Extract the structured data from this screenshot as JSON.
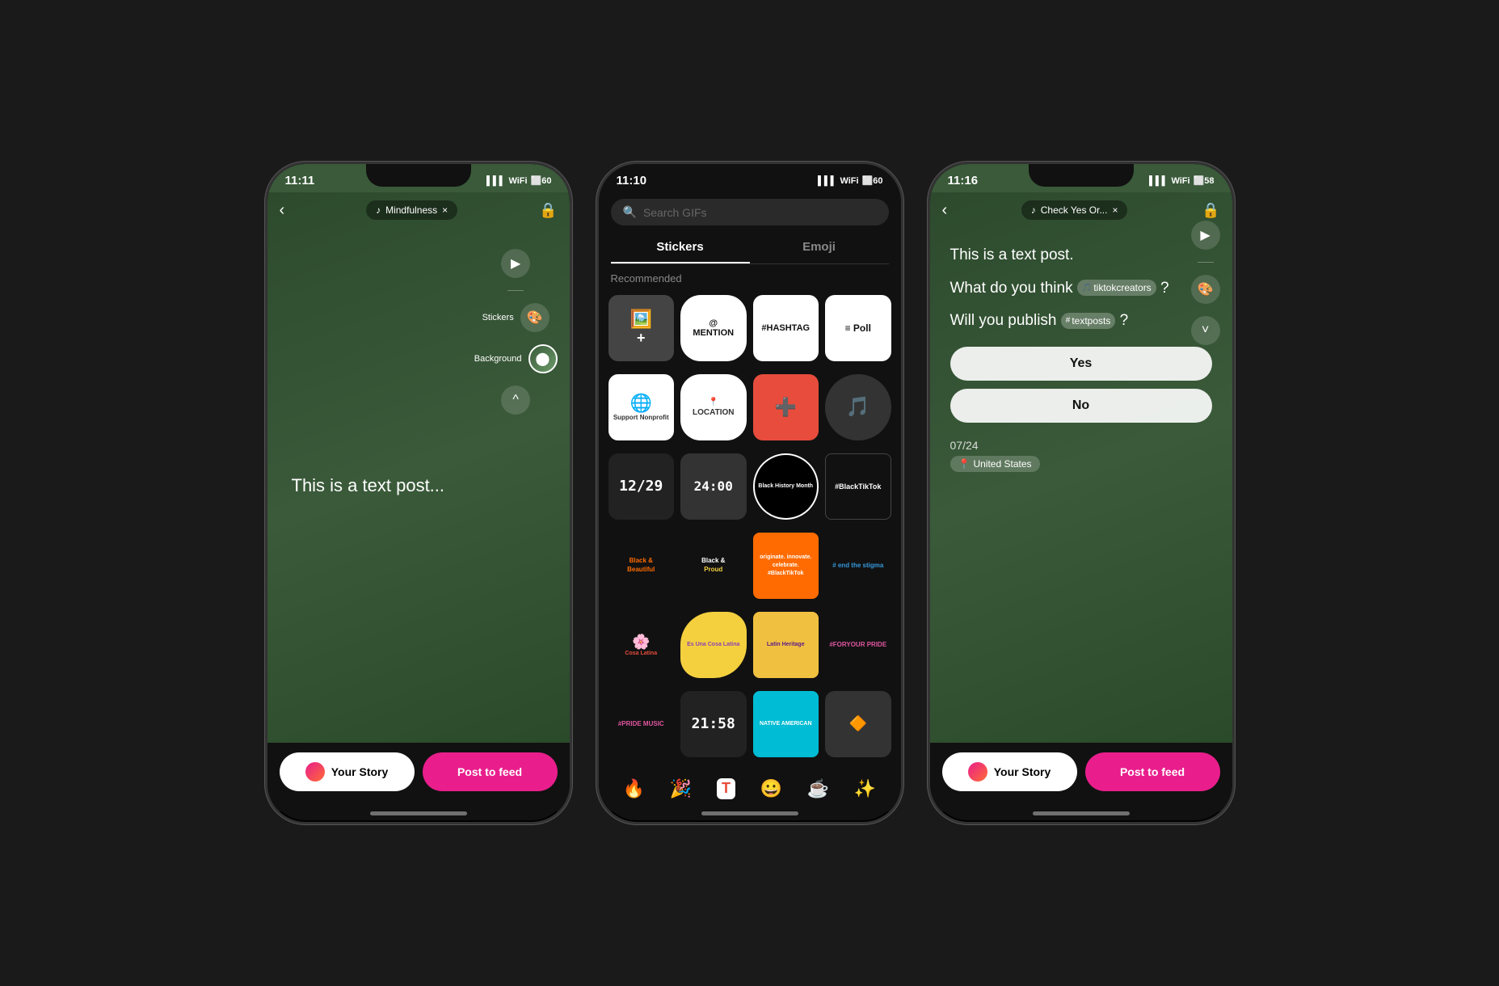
{
  "phone1": {
    "status_time": "11:11",
    "status_signal": "▌▌",
    "status_wifi": "WiFi",
    "status_battery": "60",
    "music_label": "Mindfulness",
    "close_label": "×",
    "stickers_label": "Stickers",
    "background_label": "Background",
    "post_text": "This is a text post...",
    "story_btn": "Your Story",
    "feed_btn": "Post to feed"
  },
  "phone2": {
    "status_time": "11:10",
    "search_placeholder": "Search GIFs",
    "tab_stickers": "Stickers",
    "tab_emoji": "Emoji",
    "section_recommended": "Recommended",
    "stickers": [
      {
        "id": "add-photo",
        "label": ""
      },
      {
        "id": "mention",
        "label": "@MENTION"
      },
      {
        "id": "hashtag",
        "label": "#HASHTAG"
      },
      {
        "id": "poll",
        "label": "≡ Poll"
      },
      {
        "id": "support-nonprofit",
        "label": "Support Nonprofit"
      },
      {
        "id": "location",
        "label": "📍LOCATION"
      },
      {
        "id": "aid",
        "label": ""
      },
      {
        "id": "audio-mix",
        "label": ""
      },
      {
        "id": "date-1229",
        "label": "12/29"
      },
      {
        "id": "time-2400",
        "label": "24:00"
      },
      {
        "id": "black-history",
        "label": "Black History Month"
      },
      {
        "id": "black-tiktok",
        "label": "#BlackTikTok"
      },
      {
        "id": "black-beautiful",
        "label": "Black & Beautiful"
      },
      {
        "id": "black-proud",
        "label": "Black & Proud"
      },
      {
        "id": "originate",
        "label": "originate. innovate. celebrate. #BlackTikTok"
      },
      {
        "id": "end-stigma",
        "label": "#end the stigma"
      },
      {
        "id": "cosa-latina-1",
        "label": "Cosa Latina"
      },
      {
        "id": "cosa-latina-2",
        "label": "Es Una Cosa Latina"
      },
      {
        "id": "latin-heritage",
        "label": "Latin Heritage"
      },
      {
        "id": "for-pride",
        "label": "#FORYOUR PRIDE"
      },
      {
        "id": "pride-music",
        "label": "#PRIDE MUSIC"
      },
      {
        "id": "time-2158",
        "label": "21:58"
      },
      {
        "id": "native-american",
        "label": "NATIVE AMERICAN"
      },
      {
        "id": "decor-sticker",
        "label": ""
      }
    ],
    "emojis": [
      "🔥",
      "🎉",
      "🅣",
      "😀",
      "☕",
      "✨"
    ]
  },
  "phone3": {
    "status_time": "11:16",
    "status_battery": "58",
    "music_label": "Check Yes Or...",
    "close_label": "×",
    "post_line1": "This is a text post.",
    "post_line2_prefix": "What do you think ",
    "post_line2_tag": "tiktokcreators",
    "post_line2_suffix": "?",
    "post_line3_prefix": "Will you publish ",
    "post_line3_tag": "textposts",
    "post_line3_suffix": "?",
    "yes_label": "Yes",
    "no_label": "No",
    "post_date": "07/24",
    "location": "United States",
    "story_btn": "Your Story",
    "feed_btn": "Post to feed"
  }
}
